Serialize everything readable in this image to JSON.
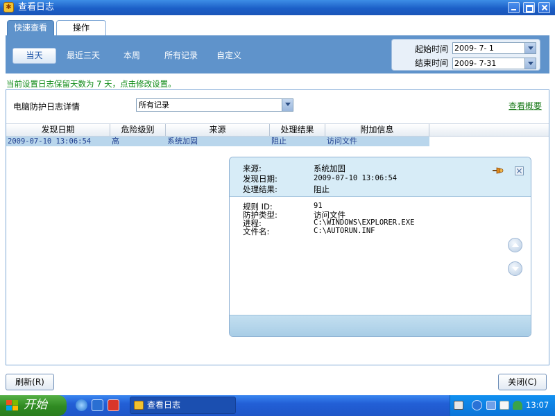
{
  "window": {
    "title": "查看日志"
  },
  "tabs": [
    {
      "label": "快速查看",
      "active": true
    },
    {
      "label": "操作",
      "active": false
    }
  ],
  "quick_filters": [
    "当天",
    "最近三天",
    "本周",
    "所有记录",
    "自定义"
  ],
  "date_range": {
    "start_label": "起始时间",
    "start_value": "2009- 7- 1",
    "end_label": "结束时间",
    "end_value": "2009- 7-31"
  },
  "retention_note": "当前设置日志保留天数为 7 天，点击修改设置。",
  "log_panel": {
    "label": "电脑防护日志详情",
    "filter_value": "所有记录",
    "summary_link": "查看概要"
  },
  "table": {
    "columns": [
      "发现日期",
      "危险级别",
      "来源",
      "处理结果",
      "附加信息"
    ],
    "rows": [
      {
        "date": "2009-07-10 13:06:54",
        "level": "高",
        "source": "系统加固",
        "result": "阻止",
        "extra": "访问文件"
      }
    ]
  },
  "detail": {
    "source_label": "来源:",
    "source_value": "系统加固",
    "date_label": "发现日期:",
    "date_value": "2009-07-10 13:06:54",
    "result_label": "处理结果:",
    "result_value": "阻止",
    "rule_id_label": "规则 ID:",
    "rule_id_value": "91",
    "protection_type_label": "防护类型:",
    "protection_type_value": "访问文件",
    "process_label": "进程:",
    "process_value": "C:\\WINDOWS\\EXPLORER.EXE",
    "filename_label": "文件名:",
    "filename_value": "C:\\AUTORUN.INF"
  },
  "buttons": {
    "refresh": "刷新(R)",
    "close": "关闭(C)"
  },
  "taskbar": {
    "start_label": "开始",
    "task_item": "查看日志",
    "clock": "13:07"
  },
  "colors": {
    "accent": "#5f93cb",
    "title_bar": "#1c5fc7",
    "link_green": "#1a7a1a",
    "note_green": "#0d8a15",
    "row_highlight": "#b9d6ec"
  }
}
